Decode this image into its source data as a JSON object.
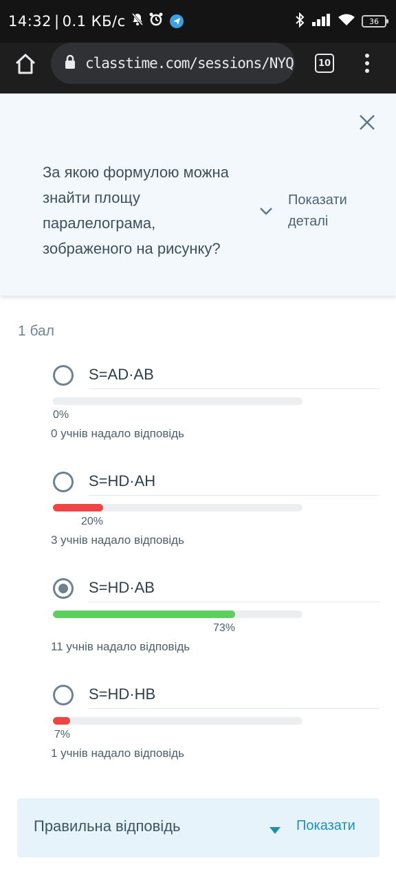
{
  "status_bar": {
    "time": "14:32",
    "speed": "0.1 КБ/с",
    "battery": "36",
    "icons": [
      "bell-off-icon",
      "alarm-icon",
      "telegram-icon",
      "bluetooth-icon",
      "signal-icon",
      "wifi-icon",
      "battery-icon"
    ]
  },
  "browser": {
    "url": "classtime.com/sessions/NYQ",
    "tab_count": "10"
  },
  "question": {
    "text": "За якою формулою можна знайти площу паралелограма, зображеного на рисунку?",
    "details_label": "Показати деталі"
  },
  "points_label": "1 бал",
  "answers": [
    {
      "label": "S=AD·AB",
      "percent": "0%",
      "percent_value": 0,
      "count_text": "0 учнів надало відповідь",
      "selected": false,
      "bar_color": "#ef4444"
    },
    {
      "label": "S=HD·AH",
      "percent": "20%",
      "percent_value": 20,
      "count_text": "3 учнів надало відповідь",
      "selected": false,
      "bar_color": "#ef4444"
    },
    {
      "label": "S=HD·AB",
      "percent": "73%",
      "percent_value": 73,
      "count_text": "11 учнів надало відповідь",
      "selected": true,
      "bar_color": "#5ccf5c"
    },
    {
      "label": "S=HD·HB",
      "percent": "7%",
      "percent_value": 7,
      "count_text": "1 учнів надало відповідь",
      "selected": false,
      "bar_color": "#ef4444"
    }
  ],
  "correct_answer": {
    "title": "Правильна відповідь",
    "show_label": "Показати"
  }
}
